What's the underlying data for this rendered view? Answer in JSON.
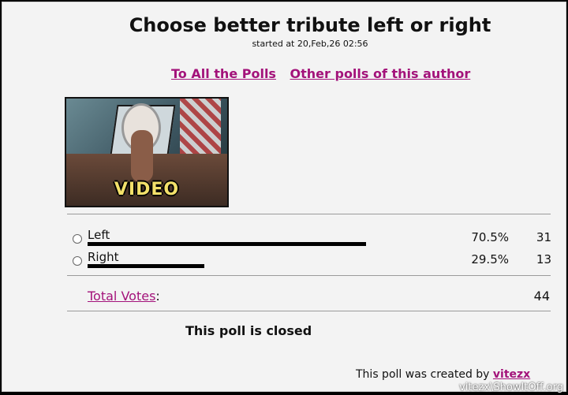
{
  "poll": {
    "title": "Choose better tribute left or right",
    "started": "started at 20,Feb,26 02:56"
  },
  "nav": {
    "all_polls": "To All the Polls",
    "author_polls": "Other polls of this author"
  },
  "media": {
    "label": "VIDEO"
  },
  "options": [
    {
      "label": "Left",
      "percent": "70.5%",
      "count": "31",
      "fraction": 0.705
    },
    {
      "label": "Right",
      "percent": "29.5%",
      "count": "13",
      "fraction": 0.295
    }
  ],
  "total": {
    "label": "Total Votes",
    "suffix": ":",
    "value": "44"
  },
  "status": "This poll is closed",
  "creator": {
    "prefix": "This poll was created by",
    "name": "vitezx"
  },
  "watermark": "vitezx\\ShowItOff.org"
}
